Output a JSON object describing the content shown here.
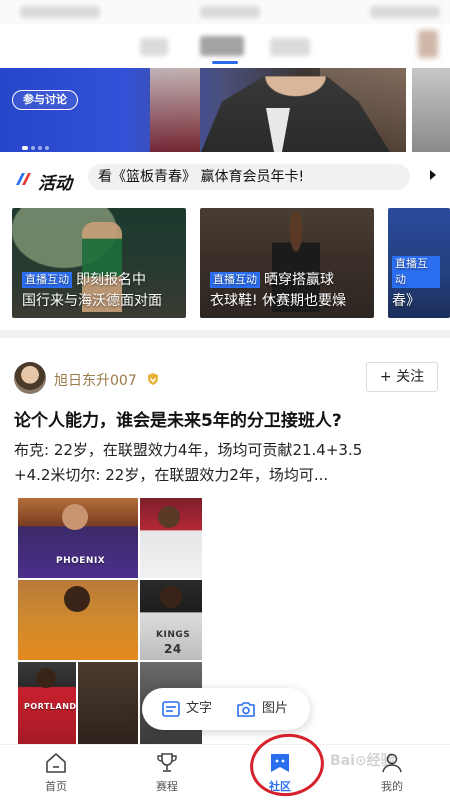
{
  "banner": {
    "discuss_label": "参与讨论",
    "slide_count": 4,
    "active_slide": 1
  },
  "activity": {
    "title": "活动",
    "headline": "看《篮板青春》 赢体育会员年卡!"
  },
  "live_cards": [
    {
      "badge": "直播互动",
      "line1": "即刻报名中",
      "line2": "国行来与海沃德面对面"
    },
    {
      "badge": "直播互动",
      "line1": "晒穿搭赢球",
      "line2": "衣球鞋! 休赛期也要燥"
    },
    {
      "badge": "直播互动",
      "line1": "",
      "line2": "春》"
    }
  ],
  "post": {
    "username": "旭日东升007",
    "follow_label": "+ 关注",
    "title": "论个人能力，谁会是未来5年的分卫接班人?",
    "body_line1": "布克: 22岁，在联盟效力4年，场均可贡献21.4+3.5",
    "body_line2": "+4.2米切尔: 22岁，在联盟效力2年，场均可..."
  },
  "jerseys": {
    "phoenix": "PHOENIX",
    "kings": "KINGS",
    "kings_no": "24",
    "portland": "PORTLAND"
  },
  "compose": {
    "text_label": "文字",
    "image_label": "图片"
  },
  "nav": {
    "home": "首页",
    "games": "赛程",
    "community": "社区",
    "mine": "我的"
  },
  "colors": {
    "accent": "#2b6ef0",
    "highlight_circle": "#d6212c"
  }
}
